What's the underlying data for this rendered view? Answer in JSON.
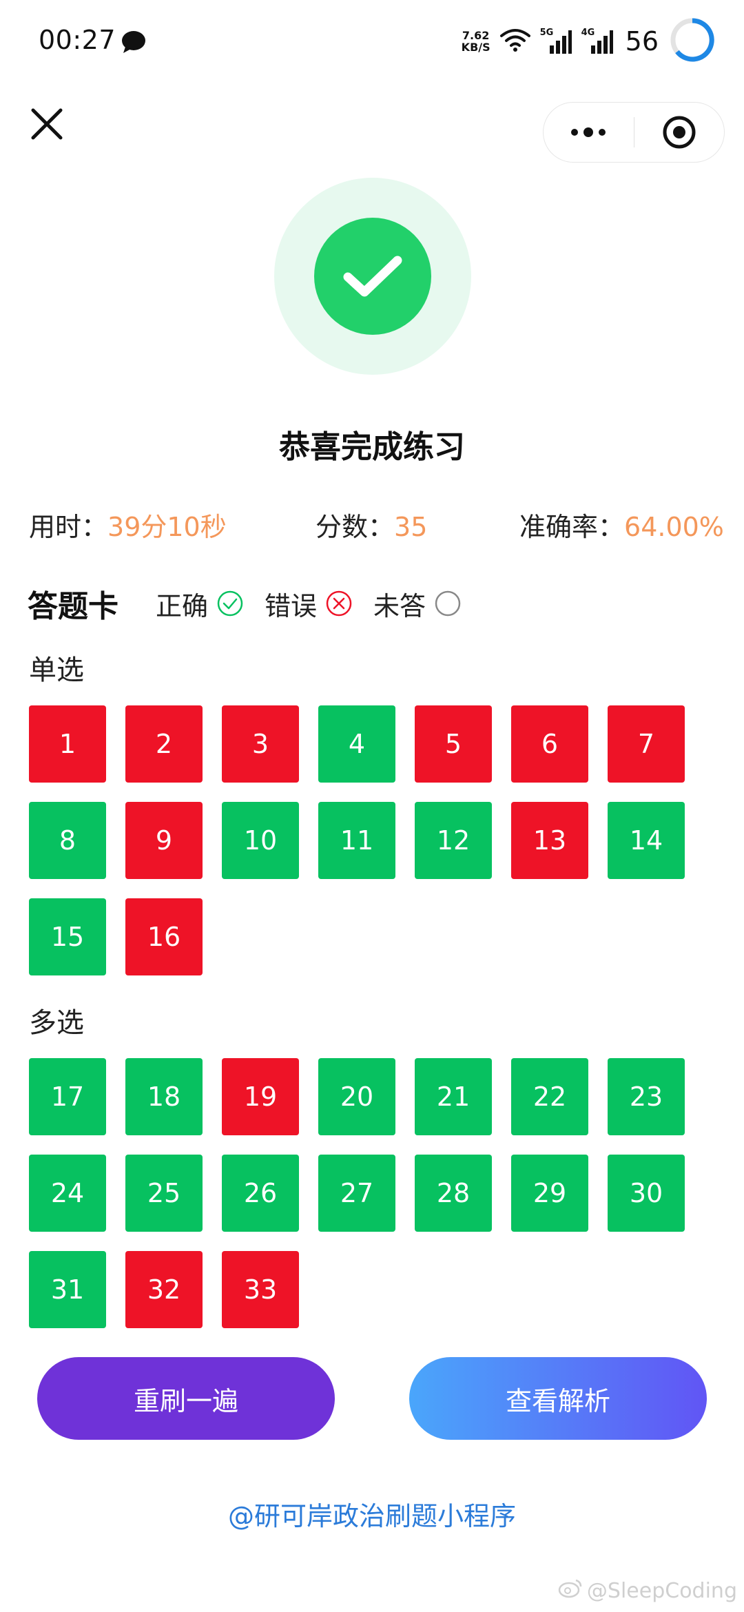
{
  "status_bar": {
    "time": "00:27",
    "net_speed_value": "7.62",
    "net_speed_unit": "KB/S",
    "signal1_label": "5G",
    "signal2_label": "4G",
    "battery": "56"
  },
  "result": {
    "title": "恭喜完成练习"
  },
  "stats": {
    "time_label": "用时：",
    "time_value": "39分10秒",
    "score_label": "分数：",
    "score_value": "35",
    "accuracy_label": "准确率：",
    "accuracy_value": "64.00%"
  },
  "answer_card": {
    "title": "答题卡",
    "legend_correct": "正确",
    "legend_wrong": "错误",
    "legend_unanswered": "未答"
  },
  "sections": [
    {
      "label": "单选",
      "questions": [
        {
          "n": "1",
          "status": "wrong"
        },
        {
          "n": "2",
          "status": "wrong"
        },
        {
          "n": "3",
          "status": "wrong"
        },
        {
          "n": "4",
          "status": "correct"
        },
        {
          "n": "5",
          "status": "wrong"
        },
        {
          "n": "6",
          "status": "wrong"
        },
        {
          "n": "7",
          "status": "wrong"
        },
        {
          "n": "8",
          "status": "correct"
        },
        {
          "n": "9",
          "status": "wrong"
        },
        {
          "n": "10",
          "status": "correct"
        },
        {
          "n": "11",
          "status": "correct"
        },
        {
          "n": "12",
          "status": "correct"
        },
        {
          "n": "13",
          "status": "wrong"
        },
        {
          "n": "14",
          "status": "correct"
        },
        {
          "n": "15",
          "status": "correct"
        },
        {
          "n": "16",
          "status": "wrong"
        }
      ]
    },
    {
      "label": "多选",
      "questions": [
        {
          "n": "17",
          "status": "correct"
        },
        {
          "n": "18",
          "status": "correct"
        },
        {
          "n": "19",
          "status": "wrong"
        },
        {
          "n": "20",
          "status": "correct"
        },
        {
          "n": "21",
          "status": "correct"
        },
        {
          "n": "22",
          "status": "correct"
        },
        {
          "n": "23",
          "status": "correct"
        },
        {
          "n": "24",
          "status": "correct"
        },
        {
          "n": "25",
          "status": "correct"
        },
        {
          "n": "26",
          "status": "correct"
        },
        {
          "n": "27",
          "status": "correct"
        },
        {
          "n": "28",
          "status": "correct"
        },
        {
          "n": "29",
          "status": "correct"
        },
        {
          "n": "30",
          "status": "correct"
        },
        {
          "n": "31",
          "status": "correct"
        },
        {
          "n": "32",
          "status": "wrong"
        },
        {
          "n": "33",
          "status": "wrong"
        }
      ]
    }
  ],
  "actions": {
    "redo_label": "重刷一遍",
    "review_label": "查看解析"
  },
  "footer": {
    "link_text": "@研可岸政治刷题小程序",
    "watermark": "@SleepCoding"
  },
  "colors": {
    "correct": "#07c160",
    "wrong": "#ee1327",
    "accent_value": "#f4975a",
    "link": "#2b7bd9"
  },
  "icons": {
    "close": "close-icon",
    "more": "more-dots-icon",
    "target": "target-icon",
    "success": "check-icon"
  }
}
